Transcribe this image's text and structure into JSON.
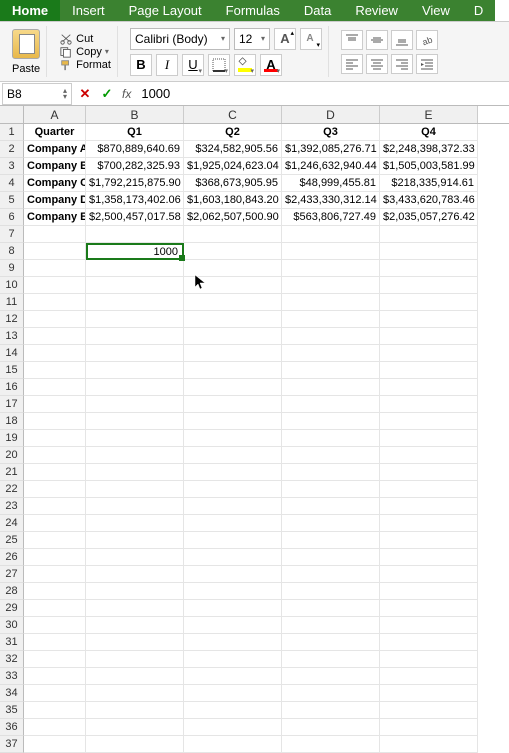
{
  "ribbon": {
    "tabs": [
      "Home",
      "Insert",
      "Page Layout",
      "Formulas",
      "Data",
      "Review",
      "View",
      "D"
    ]
  },
  "toolbar": {
    "paste": "Paste",
    "cut": "Cut",
    "copy": "Copy",
    "format": "Format",
    "font_name": "Calibri (Body)",
    "font_size": "12",
    "bold": "B",
    "italic": "I",
    "underline": "U",
    "font_A": "A",
    "increase_A": "A",
    "decrease_A": "A"
  },
  "formula_bar": {
    "name_box": "B8",
    "fx": "fx",
    "value": "1000"
  },
  "columns": [
    "A",
    "B",
    "C",
    "D",
    "E"
  ],
  "rows": [
    1,
    2,
    3,
    4,
    5,
    6,
    7,
    8,
    9,
    10,
    11,
    12,
    13,
    14,
    15,
    16,
    17,
    18,
    19,
    20,
    21,
    22,
    23,
    24,
    25,
    26,
    27,
    28,
    29,
    30,
    31,
    32,
    33,
    34,
    35,
    36,
    37
  ],
  "table": {
    "header": {
      "A": "Quarter",
      "B": "Q1",
      "C": "Q2",
      "D": "Q3",
      "E": "Q4"
    },
    "data": [
      {
        "A": "Company A",
        "B": "$870,889,640.69",
        "C": "$324,582,905.56",
        "D": "$1,392,085,276.71",
        "E": "$2,248,398,372.33"
      },
      {
        "A": "Company B",
        "B": "$700,282,325.93",
        "C": "$1,925,024,623.04",
        "D": "$1,246,632,940.44",
        "E": "$1,505,003,581.99"
      },
      {
        "A": "Company C",
        "B": "$1,792,215,875.90",
        "C": "$368,673,905.95",
        "D": "$48,999,455.81",
        "E": "$218,335,914.61"
      },
      {
        "A": "Company D",
        "B": "$1,358,173,402.06",
        "C": "$1,603,180,843.20",
        "D": "$2,433,330,312.14",
        "E": "$3,433,620,783.46"
      },
      {
        "A": "Company E",
        "B": "$2,500,457,017.58",
        "C": "$2,062,507,500.90",
        "D": "$563,806,727.49",
        "E": "$2,035,057,276.42"
      }
    ]
  },
  "active_cell": {
    "ref": "B8",
    "value": "1000",
    "col": "B",
    "row_index": 8
  }
}
